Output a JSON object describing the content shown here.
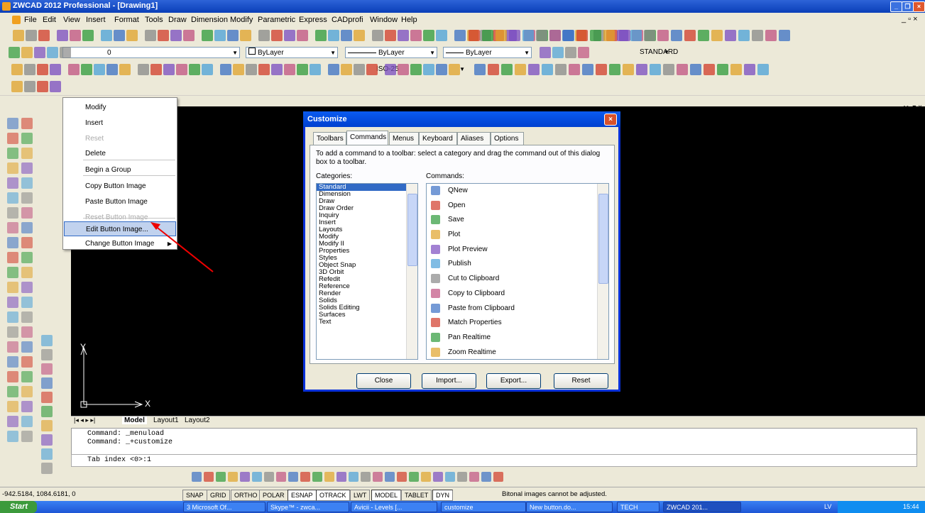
{
  "app": {
    "title": "ZWCAD 2012 Professional - [Drawing1]",
    "close_glyph": "×"
  },
  "menubar": [
    "File",
    "Edit",
    "View",
    "Insert",
    "Format",
    "Tools",
    "Draw",
    "Dimension",
    "Modify",
    "Parametric",
    "Express",
    "CADprofi",
    "Window",
    "Help"
  ],
  "properties": {
    "layer": "0",
    "color": "ByLayer",
    "linetype": "ByLayer",
    "lineweight": "ByLayer",
    "textstyle": "STANDARD",
    "dimstyle": "ISO-25"
  },
  "context_menu": {
    "items": [
      {
        "label": "Modify",
        "disabled": false
      },
      {
        "label": "Insert",
        "disabled": false
      },
      {
        "label": "Reset",
        "disabled": true
      },
      {
        "label": "Delete",
        "disabled": false
      },
      {
        "label": "Begin a Group",
        "disabled": false
      },
      {
        "label": "Copy Button Image",
        "disabled": false
      },
      {
        "label": "Paste Button Image",
        "disabled": false
      },
      {
        "label": "Reset Button Image",
        "disabled": true
      },
      {
        "label": "Edit Button Image...",
        "disabled": false,
        "highlighted": true
      },
      {
        "label": "Change Button Image",
        "disabled": false,
        "submenu": true
      }
    ]
  },
  "dialog": {
    "title": "Customize",
    "tabs": [
      "Toolbars",
      "Commands",
      "Menus",
      "Keyboard",
      "Aliases",
      "Options"
    ],
    "active_tab": "Commands",
    "instructions": "To add a command to a toolbar: select a category and drag the command out of this dialog box to a toolbar.",
    "categories_label": "Categories:",
    "commands_label": "Commands:",
    "categories": [
      "Standard",
      "Dimension",
      "Draw",
      "Draw Order",
      "Inquiry",
      "Insert",
      "Layouts",
      "Modify",
      "Modify II",
      "Properties",
      "Styles",
      "Object Snap",
      "3D Orbit",
      "Refedit",
      "Reference",
      "Render",
      "Solids",
      "Solids Editing",
      "Surfaces",
      "Text"
    ],
    "selected_category": "Standard",
    "commands": [
      "QNew",
      "Open",
      "Save",
      "Plot",
      "Plot Preview",
      "Publish",
      "Cut to Clipboard",
      "Copy to Clipboard",
      "Paste from Clipboard",
      "Match Properties",
      "Pan Realtime",
      "Zoom Realtime"
    ],
    "buttons": {
      "close": "Close",
      "import": "Import...",
      "export": "Export...",
      "reset": "Reset"
    }
  },
  "drawing": {
    "axis_x": "X",
    "axis_y": "Y",
    "layout_tabs": [
      "Model",
      "Layout1",
      "Layout2"
    ],
    "active_layout": "Model"
  },
  "command_line": {
    "history": [
      "Command:  _menuload",
      "Command:  _+customize"
    ],
    "input": "Tab index <0>:1"
  },
  "status": {
    "coords": "-942.5184,  1084.6181,  0",
    "toggles": [
      {
        "label": "SNAP",
        "on": false
      },
      {
        "label": "GRID",
        "on": false
      },
      {
        "label": "ORTHO",
        "on": false
      },
      {
        "label": "POLAR",
        "on": false
      },
      {
        "label": "ESNAP",
        "on": true
      },
      {
        "label": "OTRACK",
        "on": true
      },
      {
        "label": "LWT",
        "on": false
      },
      {
        "label": "MODEL",
        "on": true
      },
      {
        "label": "TABLET",
        "on": false
      },
      {
        "label": "DYN",
        "on": true
      }
    ],
    "message": "Bitonal images cannot be adjusted."
  },
  "taskbar": {
    "start": "Start",
    "tasks": [
      "3 Microsoft Of...",
      "Skype™ - zwca...",
      "Avicii - Levels [...",
      "customize",
      "New button.do...",
      "TECH",
      "ZWCAD 201..."
    ],
    "lang": "LV",
    "clock": "15:44"
  }
}
